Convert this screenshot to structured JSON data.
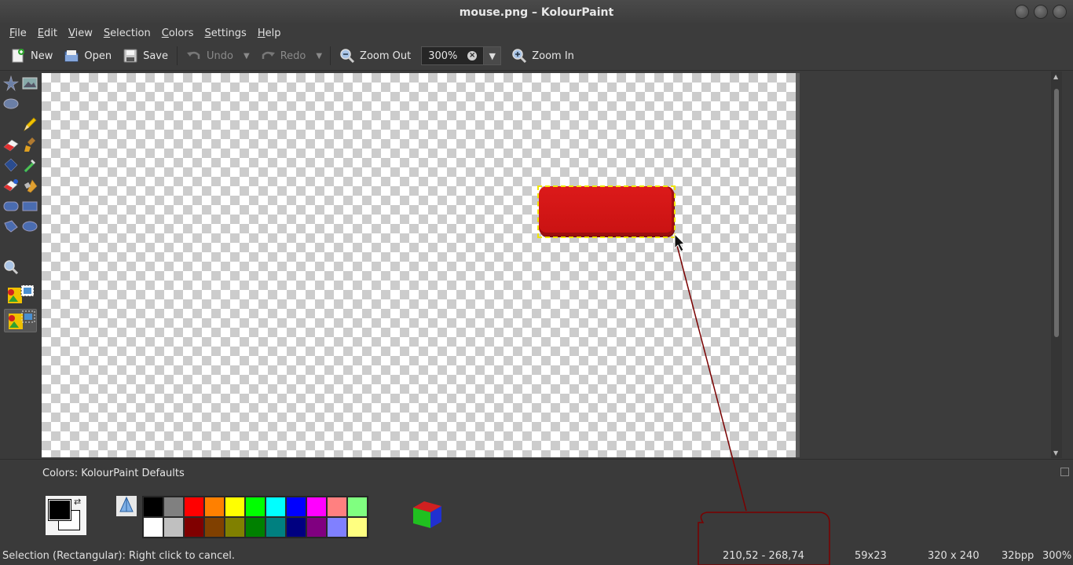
{
  "window": {
    "title": "mouse.png – KolourPaint"
  },
  "menu": {
    "items": [
      {
        "label": "File",
        "accel": "F",
        "rest": "ile"
      },
      {
        "label": "Edit",
        "accel": "E",
        "rest": "dit"
      },
      {
        "label": "View",
        "accel": "V",
        "rest": "iew"
      },
      {
        "label": "Selection",
        "accel": "S",
        "rest": "election"
      },
      {
        "label": "Colors",
        "accel": "C",
        "rest": "olors"
      },
      {
        "label": "Settings",
        "accel": "S",
        "rest": "ettings"
      },
      {
        "label": "Help",
        "accel": "H",
        "rest": "elp"
      }
    ]
  },
  "toolbar": {
    "new_label": "New",
    "open_label": "Open",
    "save_label": "Save",
    "undo_label": "Undo",
    "redo_label": "Redo",
    "zoom_out_label": "Zoom Out",
    "zoom_value": "300%",
    "zoom_in_label": "Zoom In"
  },
  "colors_panel": {
    "label": "Colors: KolourPaint Defaults",
    "label_accel": "K",
    "foreground": "#000000",
    "background": "#ffffff",
    "palette_row1": [
      "#000000",
      "#808080",
      "#ff0000",
      "#ff8000",
      "#ffff00",
      "#00ff00",
      "#00ffff",
      "#0000ff",
      "#ff00ff",
      "#ff8080",
      "#80ff80"
    ],
    "palette_row2": [
      "#ffffff",
      "#c0c0c0",
      "#800000",
      "#804000",
      "#808000",
      "#008000",
      "#008080",
      "#000080",
      "#800080",
      "#8080ff",
      "#ffff80"
    ]
  },
  "canvas": {
    "shape_color": "#d01414",
    "selection_color": "#1d2fd0"
  },
  "status": {
    "message": "Selection (Rectangular): Right click to cancel.",
    "coords": "210,52 - 268,74",
    "selection_size": "59x23",
    "image_size": "320 x 240",
    "bpp": "32bpp",
    "zoom": "300%"
  }
}
